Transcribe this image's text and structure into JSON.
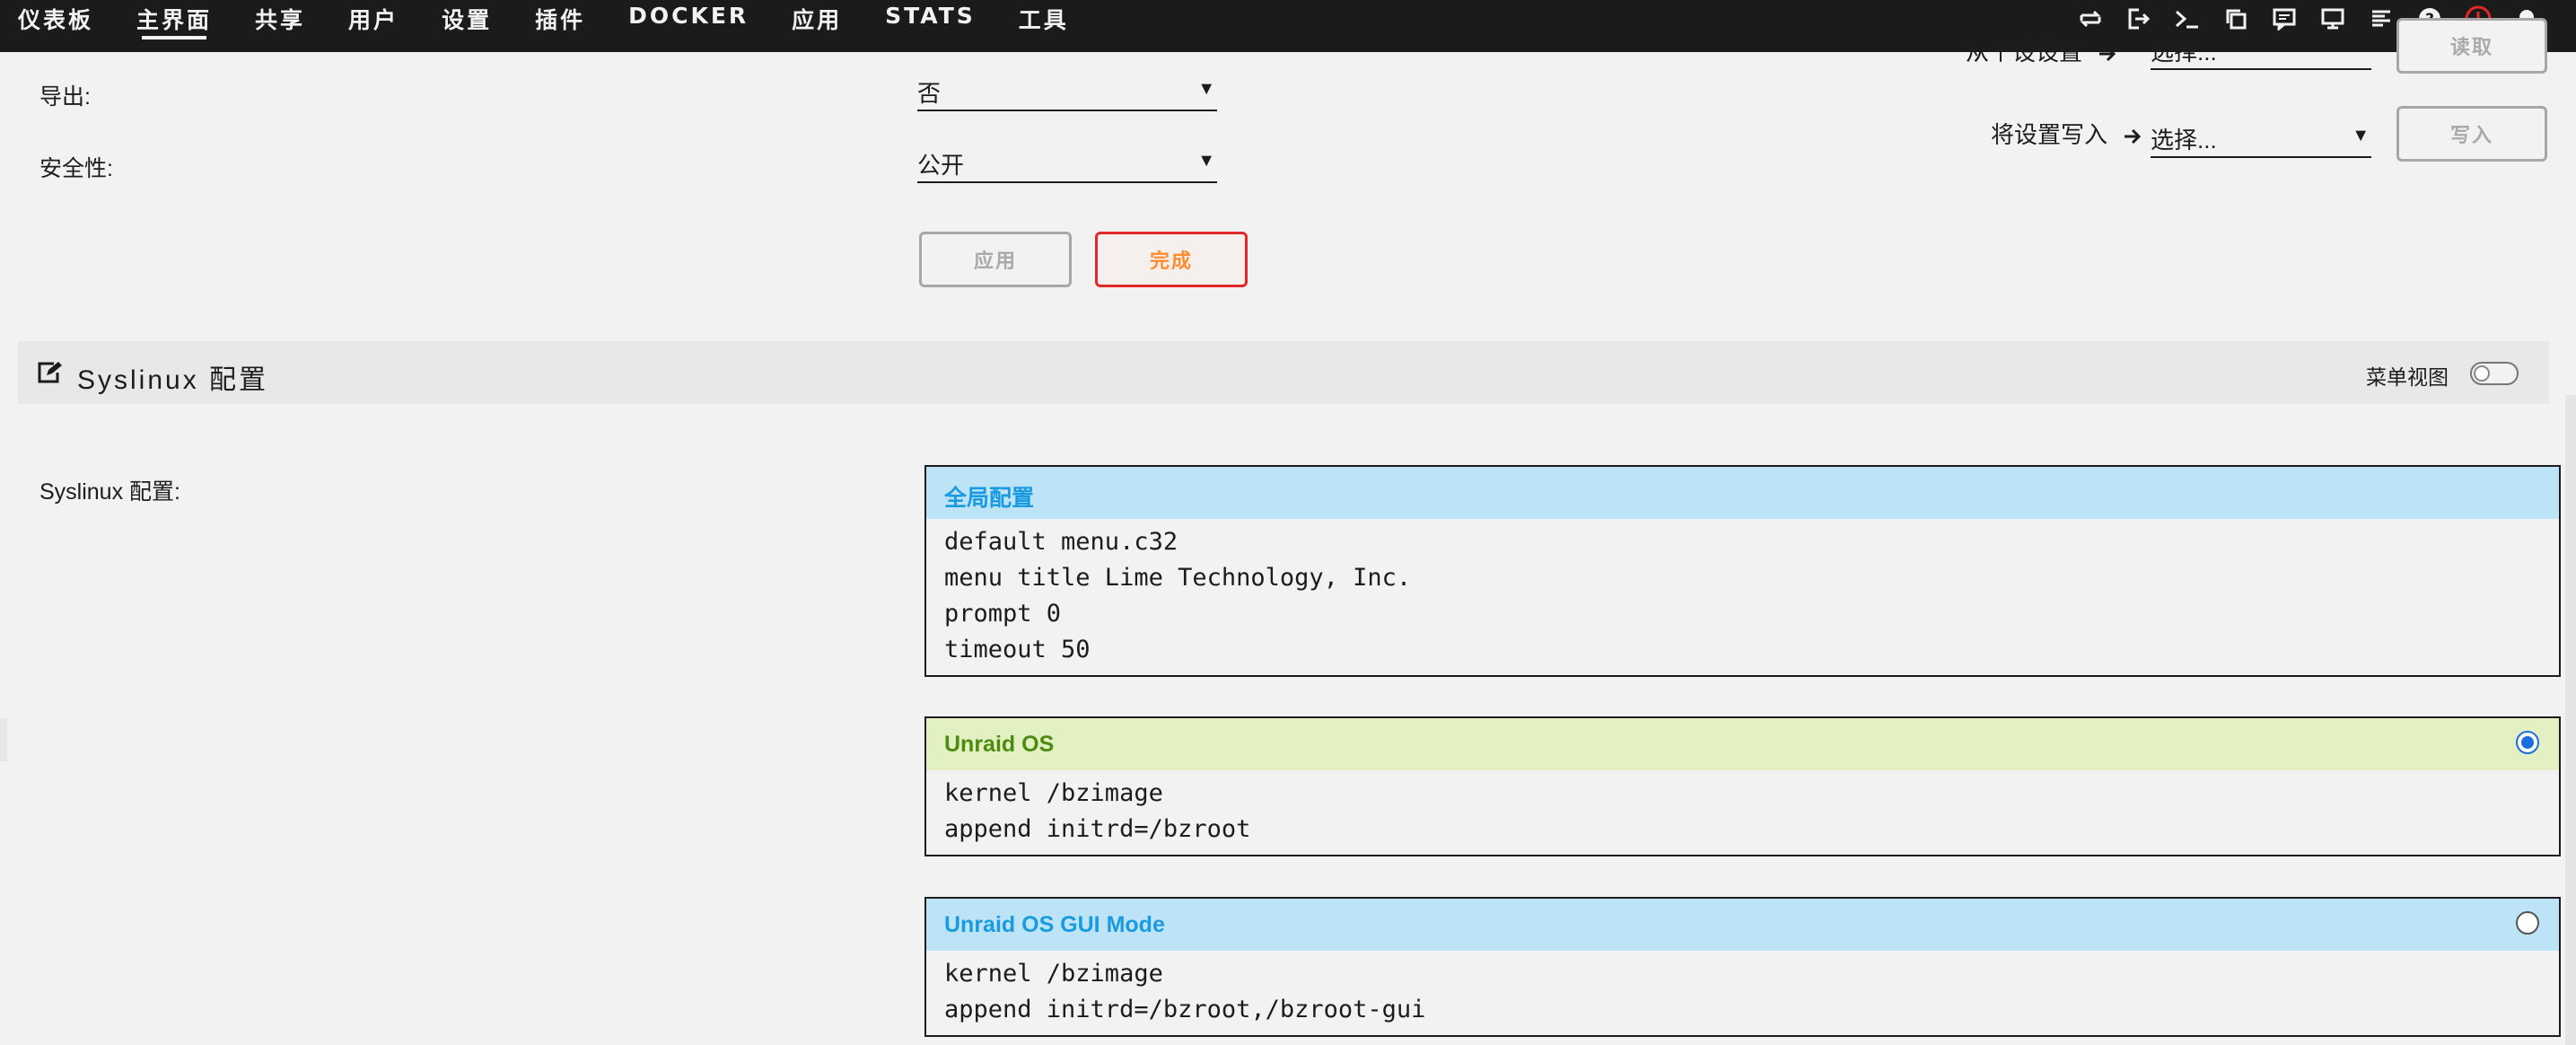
{
  "nav": {
    "items": [
      "仪表板",
      "主界面",
      "共享",
      "用户",
      "设置",
      "插件",
      "DOCKER",
      "应用",
      "STATS",
      "工具"
    ],
    "active_index": 1
  },
  "toolbar_icons": [
    "switch-language-icon",
    "logout-icon",
    "terminal-icon",
    "feedback-copy-icon",
    "info-icon",
    "monitor-icon",
    "log-icon",
    "help-icon",
    "shutdown-icon",
    "notifications-icon"
  ],
  "form": {
    "export_label": "导出:",
    "export_value": "否",
    "security_label": "安全性:",
    "security_value": "公开",
    "apply_label": "应用",
    "done_label": "完成"
  },
  "settings_panel": {
    "read_label": "从个设设置",
    "read_select": "选择...",
    "read_button": "读取",
    "write_label": "将设置写入",
    "write_select": "选择...",
    "write_button": "写入"
  },
  "section": {
    "title": "Syslinux 配置",
    "menu_view_label": "菜单视图",
    "menu_view_on": false
  },
  "syslinux": {
    "label": "Syslinux 配置:",
    "blocks": [
      {
        "title": "全局配置",
        "color": "#bde4f6",
        "has_radio": false,
        "lines": [
          "default menu.c32",
          "menu title Lime Technology, Inc.",
          "prompt 0",
          "timeout 50"
        ]
      },
      {
        "title": "Unraid OS",
        "color": "#e2f0c2",
        "has_radio": true,
        "selected": true,
        "lines": [
          "kernel /bzimage",
          "append initrd=/bzroot"
        ]
      },
      {
        "title": "Unraid OS GUI Mode",
        "color": "#bde4f6",
        "has_radio": true,
        "selected": false,
        "lines": [
          "kernel /bzimage",
          "append initrd=/bzroot,/bzroot-gui"
        ]
      }
    ]
  }
}
